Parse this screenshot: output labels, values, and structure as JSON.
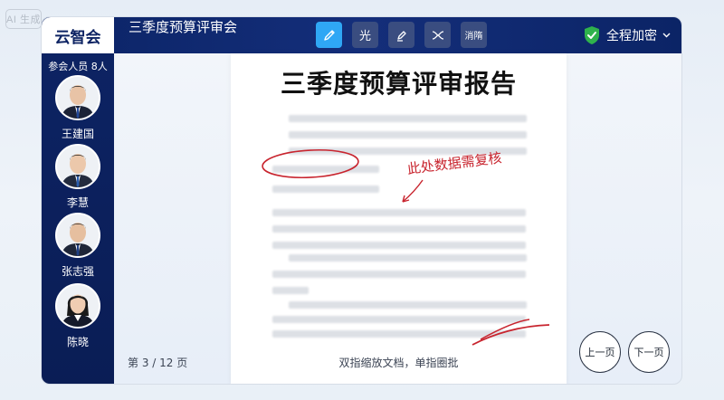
{
  "watermark": "AI 生成",
  "app": {
    "logo": "云智会",
    "meeting_title": "三季度预算评审会"
  },
  "toolbar": {
    "tools": [
      {
        "name": "pen-tool",
        "icon": "pen-icon",
        "label": "",
        "active": true
      },
      {
        "name": "laser-tool",
        "icon": "",
        "label": "光",
        "active": false
      },
      {
        "name": "highlighter-tool",
        "icon": "highlighter-icon",
        "label": "",
        "active": false
      },
      {
        "name": "eraser-tool",
        "icon": "eraser-icon",
        "label": "",
        "active": false
      },
      {
        "name": "undo-tool",
        "icon": "",
        "label": "消隋",
        "active": false
      }
    ],
    "encryption_label": "全程加密",
    "encryption_color": "#2fb24c"
  },
  "sidebar": {
    "participants_label": "参会人员 8人",
    "participants": [
      {
        "name": "王建国",
        "gender": "male"
      },
      {
        "name": "李慧",
        "gender": "male"
      },
      {
        "name": "张志强",
        "gender": "male"
      },
      {
        "name": "陈晓",
        "gender": "female"
      }
    ]
  },
  "document": {
    "title": "三季度预算评审报告",
    "annotation_note": "此处数据需复核",
    "annotation_color": "#c8242e"
  },
  "footer": {
    "page_indicator": "第 3 / 12 页",
    "hint": "双指缩放文档，单指圈批",
    "prev_label": "上一页",
    "next_label": "下一页"
  }
}
